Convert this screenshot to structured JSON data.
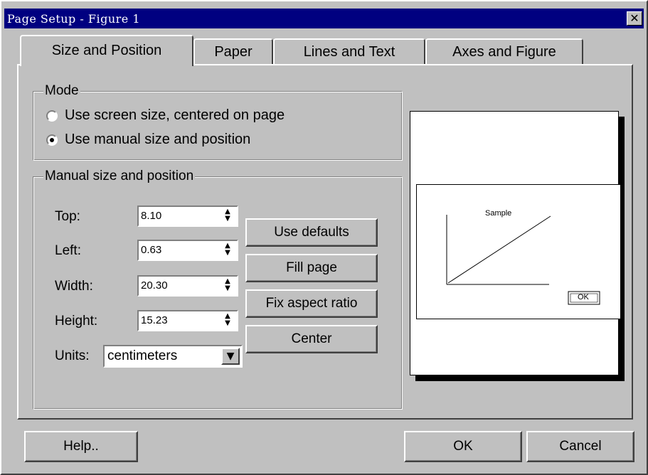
{
  "window": {
    "title": "Page Setup - Figure 1"
  },
  "tabs": [
    {
      "label": "Size and Position",
      "active": true
    },
    {
      "label": "Paper",
      "active": false
    },
    {
      "label": "Lines and Text",
      "active": false
    },
    {
      "label": "Axes and Figure",
      "active": false
    }
  ],
  "mode": {
    "label": "Mode",
    "options": [
      {
        "label": "Use screen size, centered on page",
        "selected": false
      },
      {
        "label": "Use manual size and position",
        "selected": true
      }
    ]
  },
  "manual": {
    "label": "Manual size and position",
    "fields": {
      "top": {
        "label": "Top:",
        "value": "8.10"
      },
      "left": {
        "label": "Left:",
        "value": "0.63"
      },
      "width": {
        "label": "Width:",
        "value": "20.30"
      },
      "height": {
        "label": "Height:",
        "value": "15.23"
      }
    },
    "units": {
      "label": "Units:",
      "value": "centimeters"
    },
    "buttons": {
      "use_defaults": "Use defaults",
      "fill_page": "Fill page",
      "fix_aspect": "Fix aspect ratio",
      "center": "Center"
    }
  },
  "preview": {
    "sample_label": "Sample",
    "ok_label": "OK"
  },
  "footer": {
    "help": "Help..",
    "ok": "OK",
    "cancel": "Cancel"
  },
  "icons": {
    "close": "close-icon",
    "spin": "spinner-arrows-icon",
    "dropdown": "dropdown-arrow-icon"
  }
}
